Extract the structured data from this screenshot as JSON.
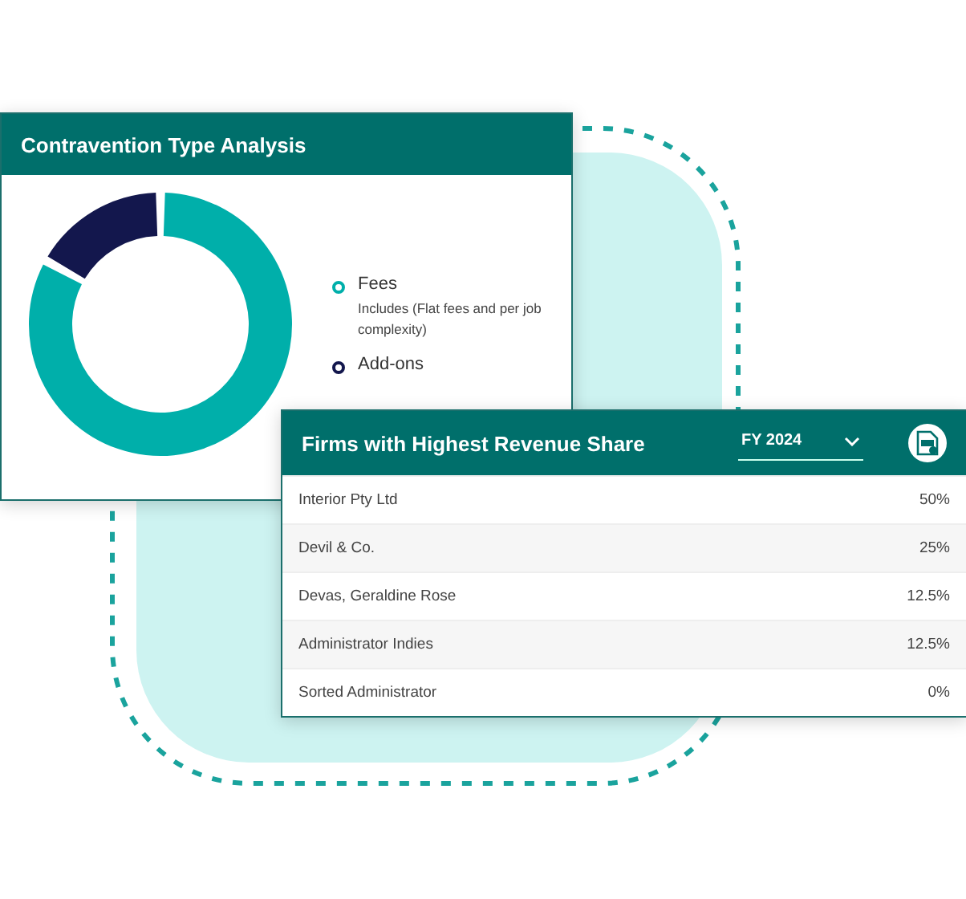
{
  "contravention_card": {
    "title": "Contravention Type Analysis",
    "legend": [
      {
        "label": "Fees",
        "note": "Includes (Flat fees and per job complexity)",
        "color": "#00afaa"
      },
      {
        "label": "Add-ons",
        "color": "#13174d"
      }
    ]
  },
  "revenue_card": {
    "title": "Firms with Highest Revenue Share",
    "year_select": {
      "value": "FY 2024"
    },
    "rows": [
      {
        "firm": "Interior Pty Ltd",
        "share": "50%"
      },
      {
        "firm": "Devil & Co.",
        "share": "25%"
      },
      {
        "firm": "Devas, Geraldine Rose",
        "share": "12.5%"
      },
      {
        "firm": "Administrator Indies",
        "share": "12.5%"
      },
      {
        "firm": "Sorted Administrator",
        "share": "0%"
      }
    ]
  }
}
